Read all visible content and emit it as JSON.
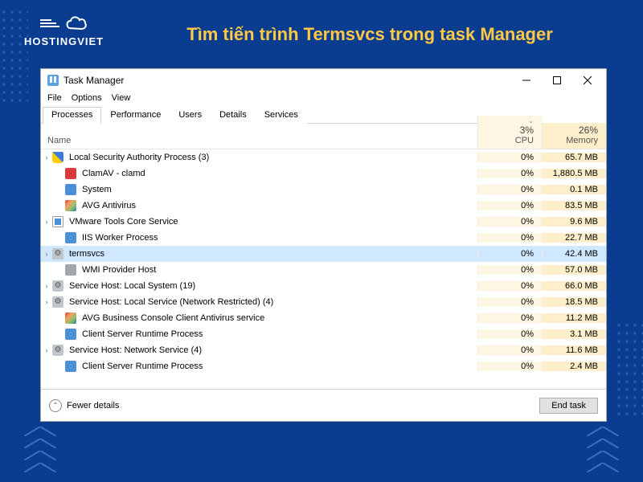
{
  "brand": {
    "name": "HOSTINGVIET"
  },
  "page_title": "Tìm tiến trình Termsvcs trong task Manager",
  "window": {
    "title": "Task Manager",
    "menu": [
      "File",
      "Options",
      "View"
    ],
    "tabs": [
      "Processes",
      "Performance",
      "Users",
      "Details",
      "Services"
    ],
    "active_tab": 0,
    "columns": {
      "name": "Name",
      "cpu_label": "CPU",
      "cpu_pct": "3%",
      "mem_label": "Memory",
      "mem_pct": "26%"
    },
    "rows": [
      {
        "expandable": true,
        "child": false,
        "selected": false,
        "icon": "ico-shield",
        "name": "Local Security Authority Process (3)",
        "cpu": "0%",
        "mem": "65.7 MB"
      },
      {
        "expandable": false,
        "child": true,
        "selected": false,
        "icon": "ico-clam",
        "name": "ClamAV - clamd",
        "cpu": "0%",
        "mem": "1,880.5 MB"
      },
      {
        "expandable": false,
        "child": true,
        "selected": false,
        "icon": "ico-sys",
        "name": "System",
        "cpu": "0%",
        "mem": "0.1 MB"
      },
      {
        "expandable": false,
        "child": true,
        "selected": false,
        "icon": "ico-avg",
        "name": "AVG Antivirus",
        "cpu": "0%",
        "mem": "83.5 MB"
      },
      {
        "expandable": true,
        "child": false,
        "selected": false,
        "icon": "ico-vm",
        "name": "VMware Tools Core Service",
        "cpu": "0%",
        "mem": "9.6 MB"
      },
      {
        "expandable": false,
        "child": true,
        "selected": false,
        "icon": "ico-iis",
        "name": "IIS Worker Process",
        "cpu": "0%",
        "mem": "22.7 MB"
      },
      {
        "expandable": true,
        "child": false,
        "selected": true,
        "icon": "ico-gear",
        "name": "termsvcs",
        "cpu": "0%",
        "mem": "42.4 MB"
      },
      {
        "expandable": false,
        "child": true,
        "selected": false,
        "icon": "ico-wmi",
        "name": "WMI Provider Host",
        "cpu": "0%",
        "mem": "57.0 MB"
      },
      {
        "expandable": true,
        "child": false,
        "selected": false,
        "icon": "ico-gear",
        "name": "Service Host: Local System (19)",
        "cpu": "0%",
        "mem": "66.0 MB"
      },
      {
        "expandable": true,
        "child": false,
        "selected": false,
        "icon": "ico-gear",
        "name": "Service Host: Local Service (Network Restricted) (4)",
        "cpu": "0%",
        "mem": "18.5 MB"
      },
      {
        "expandable": false,
        "child": true,
        "selected": false,
        "icon": "ico-avg",
        "name": "AVG Business Console Client Antivirus service",
        "cpu": "0%",
        "mem": "11.2 MB"
      },
      {
        "expandable": false,
        "child": true,
        "selected": false,
        "icon": "ico-csr",
        "name": "Client Server Runtime Process",
        "cpu": "0%",
        "mem": "3.1 MB"
      },
      {
        "expandable": true,
        "child": false,
        "selected": false,
        "icon": "ico-gear",
        "name": "Service Host: Network Service (4)",
        "cpu": "0%",
        "mem": "11.6 MB"
      },
      {
        "expandable": false,
        "child": true,
        "selected": false,
        "icon": "ico-csr",
        "name": "Client Server Runtime Process",
        "cpu": "0%",
        "mem": "2.4 MB"
      }
    ],
    "footer": {
      "fewer": "Fewer details",
      "end_task": "End task"
    }
  }
}
